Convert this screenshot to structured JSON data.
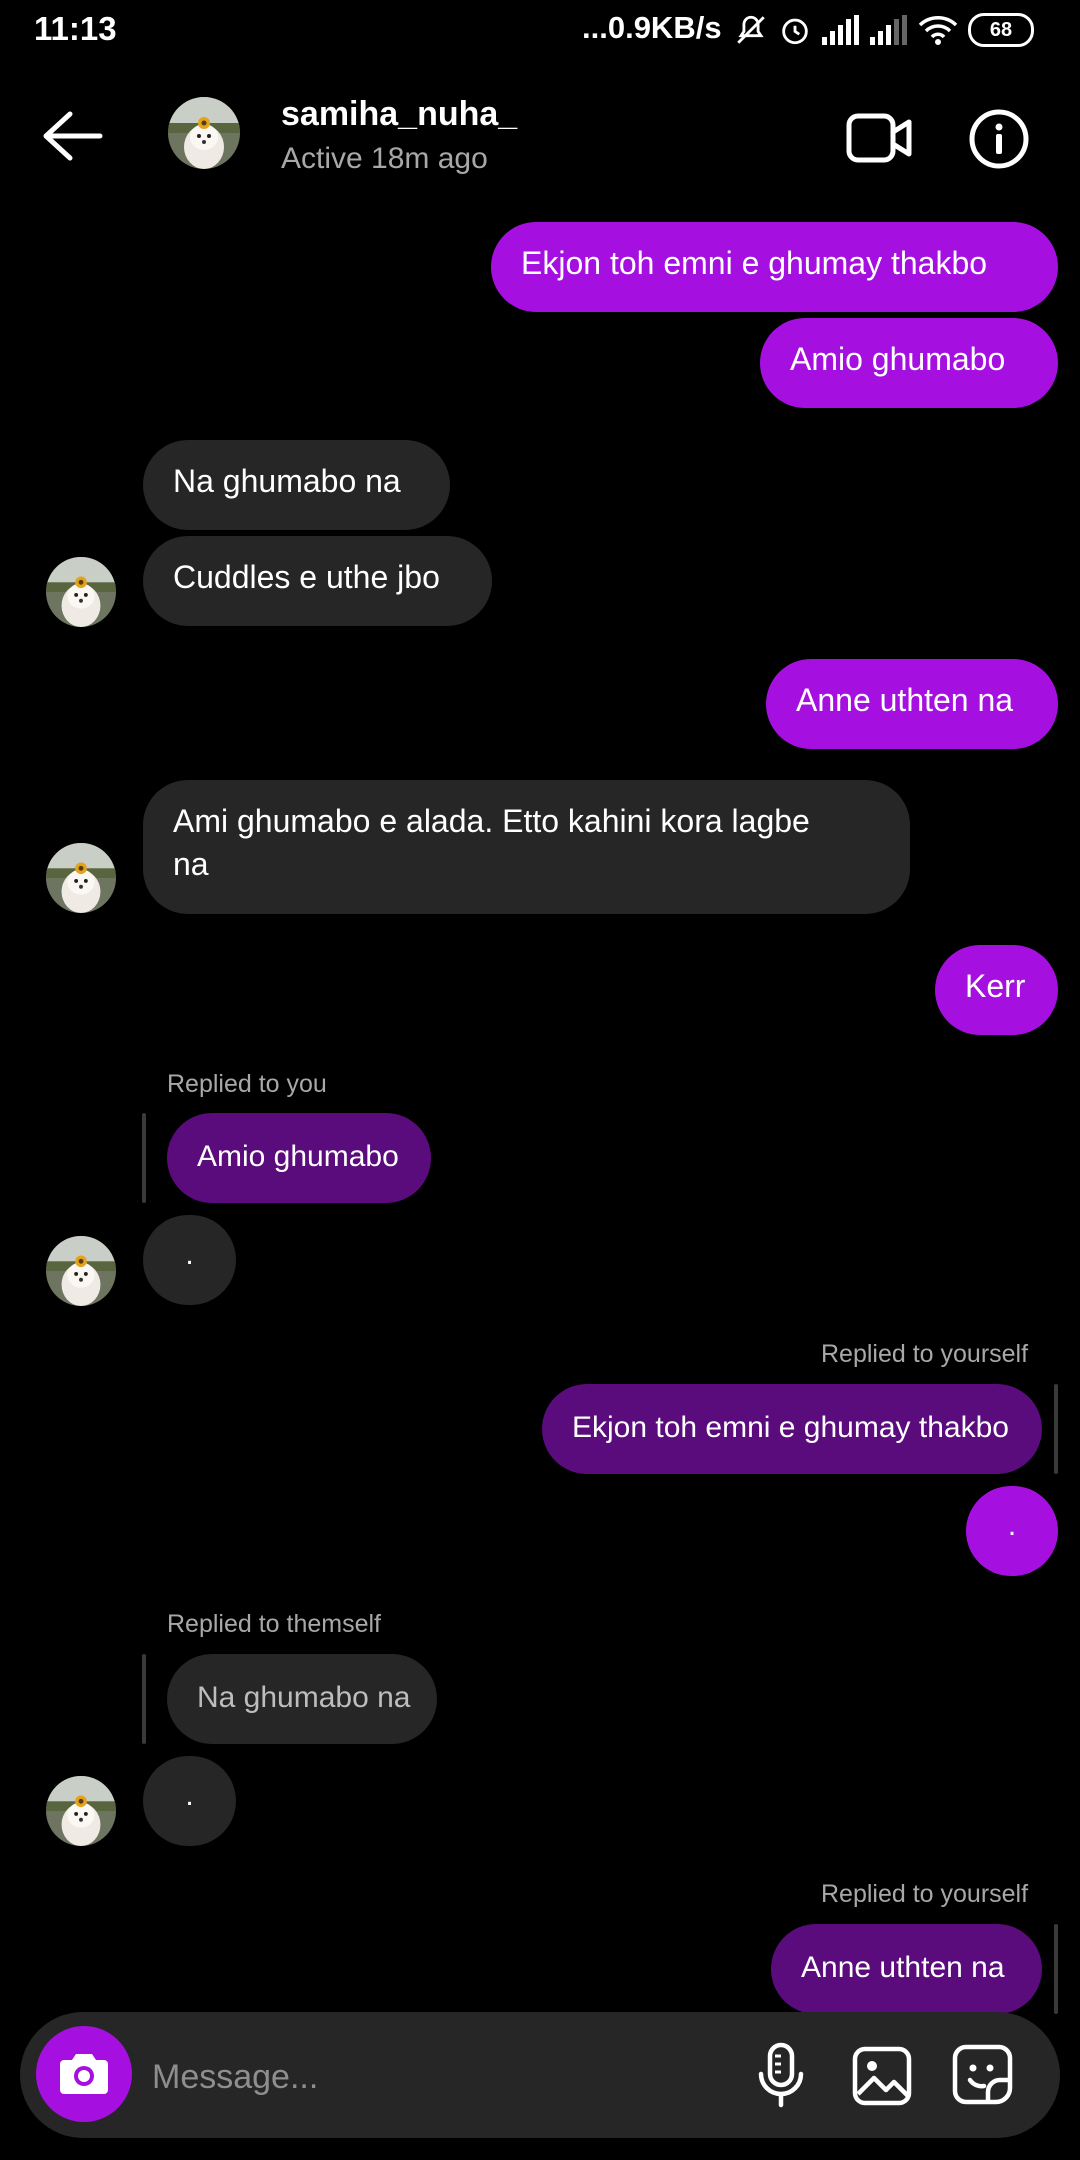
{
  "status_bar": {
    "time": "11:13",
    "network": "...0.9KB/s",
    "battery": "68"
  },
  "header": {
    "username": "samiha_nuha_",
    "status": "Active 18m ago"
  },
  "messages": [
    {
      "text": "Ekjon toh emni e ghumay thakbo"
    },
    {
      "text": "Amio ghumabo"
    },
    {
      "text": "Na ghumabo na"
    },
    {
      "text": "Cuddles e uthe jbo"
    },
    {
      "text": "Anne uthten na"
    },
    {
      "text": "Ami ghumabo e alada. Etto kahini kora lagbe",
      "text2": "na"
    },
    {
      "text": "Kerr"
    },
    {
      "label": "Replied to you",
      "quote": "Amio ghumabo",
      "text": "."
    },
    {
      "label": "Replied to yourself",
      "quote": "Ekjon toh emni e ghumay thakbo",
      "text": "."
    },
    {
      "label": "Replied to themself",
      "quote": "Na ghumabo na",
      "text": "."
    },
    {
      "label": "Replied to yourself",
      "quote": "Anne uthten na"
    }
  ],
  "composer": {
    "placeholder": "Message..."
  },
  "colors": {
    "outgoing_bubble": "#a510e0",
    "incoming_bubble": "#262626",
    "reply_outgoing": "#5b0c7c"
  },
  "icons": {
    "back": "arrow-left-icon",
    "video": "video-camera-icon",
    "info": "info-icon",
    "camera": "camera-icon",
    "mic": "microphone-icon",
    "gallery": "image-icon",
    "sticker": "sticker-icon"
  }
}
